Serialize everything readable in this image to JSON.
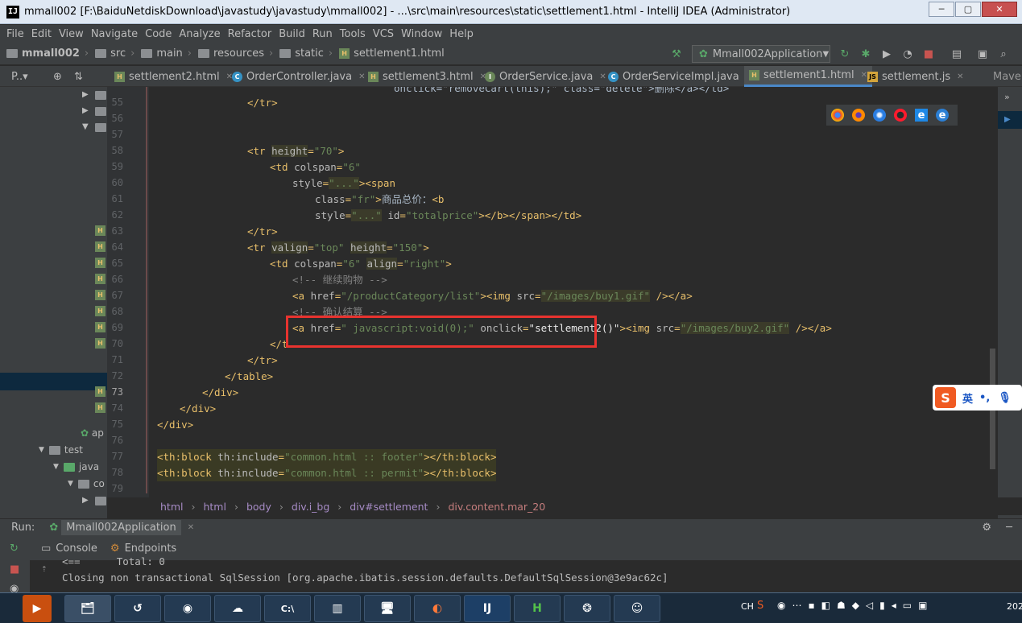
{
  "window": {
    "title": "mmall002 [F:\\BaiduNetdiskDownload\\javastudy\\javastudy\\mmall002] - ...\\src\\main\\resources\\static\\settlement1.html - IntelliJ IDEA (Administrator)",
    "app_icon": "IJ"
  },
  "menu": [
    "File",
    "Edit",
    "View",
    "Navigate",
    "Code",
    "Analyze",
    "Refactor",
    "Build",
    "Run",
    "Tools",
    "VCS",
    "Window",
    "Help"
  ],
  "nav": {
    "crumbs": [
      "mmall002",
      "src",
      "main",
      "resources",
      "static",
      "settlement1.html"
    ],
    "run_config": "Mmall002Application"
  },
  "tabs": {
    "project_label": "P..▾",
    "files": [
      {
        "label": "settlement2.html",
        "type": "html"
      },
      {
        "label": "OrderController.java",
        "type": "java"
      },
      {
        "label": "settlement3.html",
        "type": "html"
      },
      {
        "label": "OrderService.java",
        "type": "iface"
      },
      {
        "label": "OrderServiceImpl.java",
        "type": "java"
      },
      {
        "label": "settlement1.html",
        "type": "html",
        "active": true
      },
      {
        "label": "settlement.js",
        "type": "js"
      }
    ],
    "maven": "Mave"
  },
  "project_tree": {
    "items": [
      "ap",
      "test",
      "java",
      "co"
    ]
  },
  "editor": {
    "line_numbers": [
      "55",
      "56",
      "57",
      "58",
      "59",
      "60",
      "61",
      "62",
      "63",
      "64",
      "65",
      "66",
      "67",
      "68",
      "69",
      "70",
      "71",
      "72",
      "73",
      "74",
      "75",
      "76",
      "77",
      "78",
      "79"
    ],
    "top_partial": "onclick=\"removeCart(this);\" class=\"delete\">删除</a></td>",
    "l55": "</tr>",
    "l58_tag": "<tr ",
    "l58_attr": "height",
    "l58_val": "\"70\"",
    "l58_end": ">",
    "l59_tag": "<td ",
    "l59_attr": "colspan",
    "l59_val": "\"6\"",
    "l60_attr": "style",
    "l60_val": "\"...\"",
    "l60_tag": "><span",
    "l61_attr": "class",
    "l61_val": "\"fr\"",
    "l61_text": "商品总价：",
    "l61_tag": "<b",
    "l62_attr": "style",
    "l62_val": "\"...\"",
    "l62_attr2": "id",
    "l62_val2": "\"totalprice\"",
    "l62_end": "></b></span></td>",
    "l63": "</tr>",
    "l64_tag": "<tr ",
    "l64_attr": "valign",
    "l64_val": "\"top\"",
    "l64_attr2": "height",
    "l64_val2": "\"150\"",
    "l64_end": ">",
    "l65_tag": "<td ",
    "l65_attr": "colspan",
    "l65_val": "\"6\"",
    "l65_attr2": "align",
    "l65_val2": "\"right\"",
    "l65_end": ">",
    "l66": "<!-- 继续购物 -->",
    "l67_tag": "<a ",
    "l67_attr": "href",
    "l67_val": "\"/productCategory/list\"",
    "l67_tag2": "><img ",
    "l67_attr2": "src",
    "l67_val2": "\"/images/buy1.gif\"",
    "l67_end": " /></a>",
    "l68": "<!-- 确认结算 -->",
    "l69_tag": "<a ",
    "l69_attr": "href",
    "l69_val": "\" javascript:void(0);\"",
    "l69_attr2": " onclick",
    "l69_val2": "\"settlement2()\"",
    "l69_tag2": "><img ",
    "l69_attr3": "src",
    "l69_val3": "\"/images/buy2.gif\"",
    "l69_end": " /></a>",
    "l70": "</t",
    "l71": "</tr>",
    "l72": "</table>",
    "l73": "</div>",
    "l74": "</div>",
    "l75": "</div>",
    "l77_open": "<th:block ",
    "l77_attr": "th:include",
    "l77_val": "\"common.html :: footer\"",
    "l77_close": "></th:block>",
    "l78_open": "<th:block ",
    "l78_attr": "th:include",
    "l78_val": "\"common.html :: permit\"",
    "l78_close": "></th:block>"
  },
  "editor_breadcrumb": [
    "html",
    "html",
    "body",
    "div.i_bg",
    "div#settlement",
    "div.content.mar_20"
  ],
  "run": {
    "label": "Run:",
    "config": "Mmall002Application",
    "tabs": [
      "Console",
      "Endpoints"
    ],
    "lines": [
      "<==      Total: 0",
      "Closing non transactional SqlSession [org.apache.ibatis.session.defaults.DefaultSqlSession@3e9ac62c]"
    ]
  },
  "ime": {
    "label": "英",
    "punct": "•,"
  },
  "taskbar": {
    "clock": "202",
    "tray_text": "CH"
  },
  "colors": {
    "accent": "#4a88c7",
    "highlight_box": "#e8332f"
  }
}
